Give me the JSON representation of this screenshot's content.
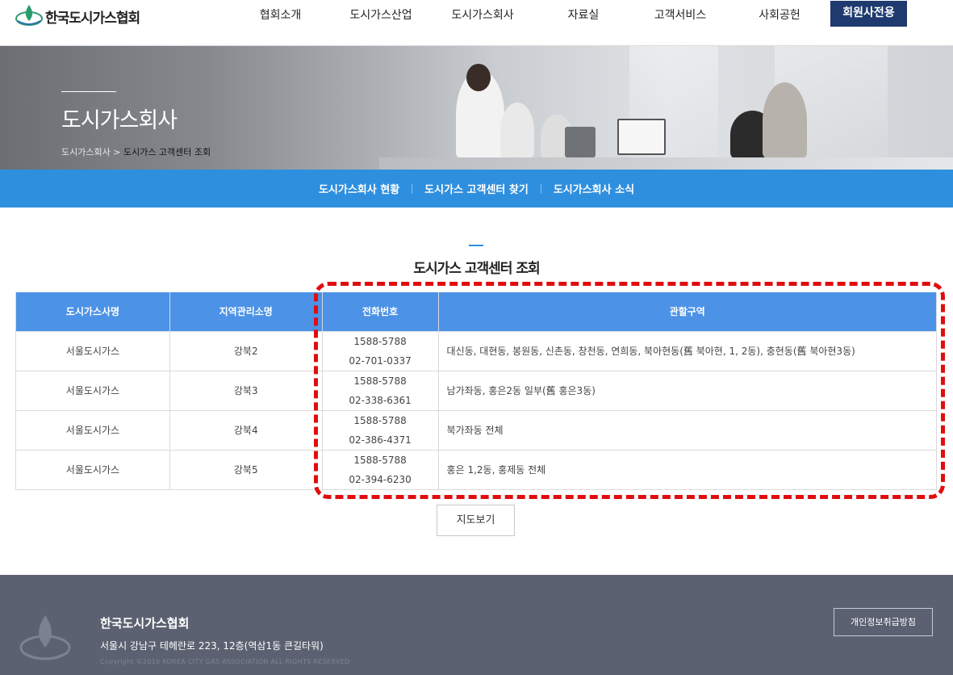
{
  "brand": {
    "name": "한국도시가스협회"
  },
  "nav": {
    "items": [
      "협회소개",
      "도시가스산업",
      "도시가스회사",
      "자료실",
      "고객서비스",
      "사회공헌"
    ],
    "members": "회원사전용"
  },
  "hero": {
    "title": "도시가스회사",
    "breadcrumb_parent": "도시가스회사",
    "breadcrumb_sep": " > ",
    "breadcrumb_current": "도시가스 고객센터 조회"
  },
  "subnav": [
    "도시가스회사 현황",
    "도시가스 고객센터 찾기",
    "도시가스회사 소식"
  ],
  "section": {
    "title": "도시가스 고객센터 조회"
  },
  "table": {
    "headers": [
      "도시가스사명",
      "지역관리소명",
      "전화번호",
      "관할구역"
    ],
    "rows": [
      {
        "company": "서울도시가스",
        "office": "강북2",
        "phone1": "1588-5788",
        "phone2": "02-701-0337",
        "area": "대신동, 대현동, 봉원동, 신촌동, 창천동, 연희동, 북아현동(舊 북아현, 1, 2동), 충현동(舊 북아현3동)"
      },
      {
        "company": "서울도시가스",
        "office": "강북3",
        "phone1": "1588-5788",
        "phone2": "02-338-6361",
        "area": "남가좌동, 홍은2동 일부(舊 홍은3동)"
      },
      {
        "company": "서울도시가스",
        "office": "강북4",
        "phone1": "1588-5788",
        "phone2": "02-386-4371",
        "area": "북가좌동 전체"
      },
      {
        "company": "서울도시가스",
        "office": "강북5",
        "phone1": "1588-5788",
        "phone2": "02-394-6230",
        "area": "홍은 1,2동, 홍제동 전체"
      }
    ]
  },
  "map_button": "지도보기",
  "footer": {
    "name": "한국도시가스협회",
    "address": "서울시 강남구 테헤란로 223, 12층(역삼1동 큰길타워)",
    "copyright": "Copyright ©2016 KOREA CITY GAS ASSOCIATION ALL RIGHTS RESERVED",
    "privacy": "개인정보취급방침"
  },
  "colors": {
    "brand_navy": "#1f3a6e",
    "accent_blue": "#2f8fdf",
    "table_header": "#4c92e6",
    "highlight": "#e00d0d",
    "footer_bg": "#5b6170"
  }
}
